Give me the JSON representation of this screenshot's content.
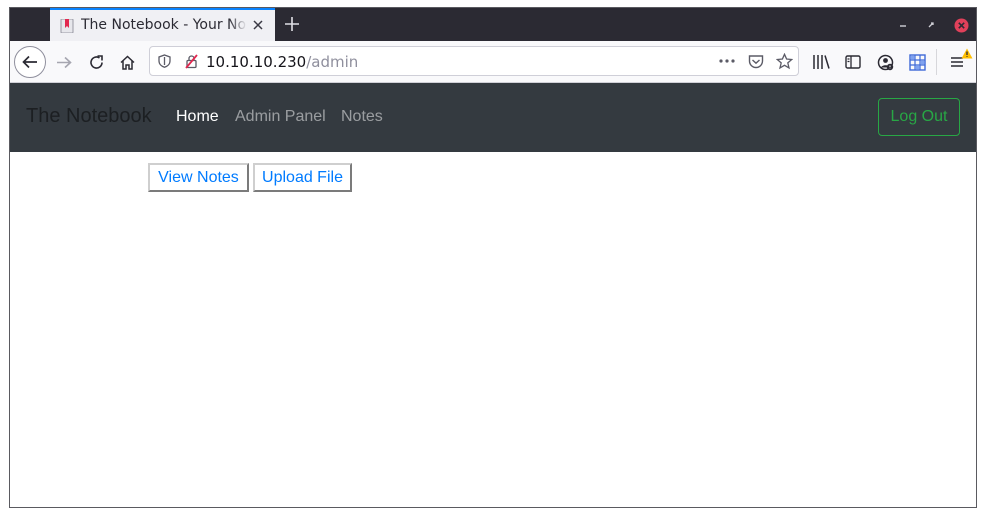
{
  "browser": {
    "tab": {
      "title": "The Notebook - Your Notes"
    },
    "url": {
      "host": "10.10.10.230",
      "path": "/admin"
    },
    "icons": {
      "back": "back-arrow-icon",
      "forward": "forward-arrow-icon",
      "reload": "reload-icon",
      "home": "home-icon",
      "tracking_protection": "shield-icon",
      "insecure_connection": "insecure-lock-icon",
      "page_actions": "more-horizontal-icon",
      "pocket": "pocket-icon",
      "bookmark": "star-icon",
      "library": "library-icon",
      "sidebar": "sidebar-icon",
      "account": "account-icon",
      "containers": "grid-icon",
      "menu": "hamburger-menu-icon",
      "menu_alert": "warning-icon"
    }
  },
  "site": {
    "brand": "The Notebook",
    "nav": [
      {
        "label": "Home",
        "active": true
      },
      {
        "label": "Admin Panel",
        "active": false
      },
      {
        "label": "Notes",
        "active": false
      }
    ],
    "logout_label": "Log Out",
    "actions": [
      {
        "label": "View Notes"
      },
      {
        "label": "Upload File"
      }
    ]
  },
  "colors": {
    "navbar_bg": "#343a40",
    "link_blue": "#007bff",
    "logout_green": "#28a745",
    "tab_accent": "#0a84ff",
    "insecure_red": "#e22850"
  }
}
